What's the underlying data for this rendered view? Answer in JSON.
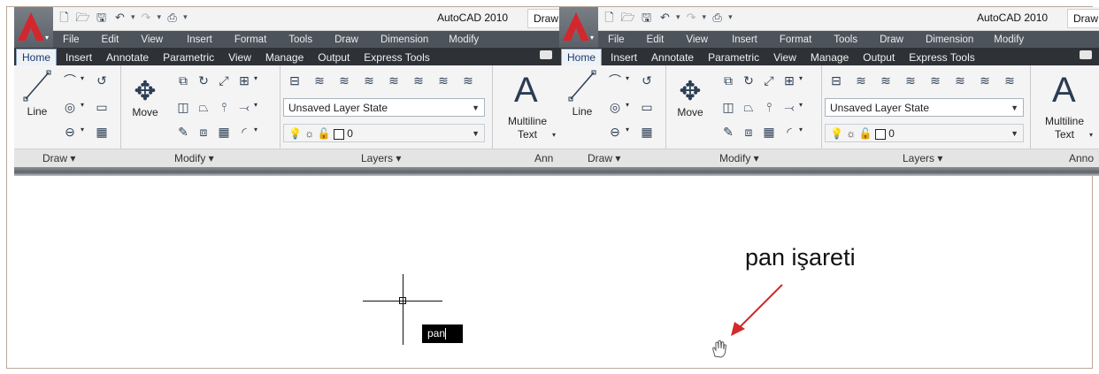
{
  "left_window": {
    "app_title": "AutoCAD 2010",
    "draw_tab": "Draw",
    "menu": [
      "File",
      "Edit",
      "View",
      "Insert",
      "Format",
      "Tools",
      "Draw",
      "Dimension",
      "Modify"
    ],
    "tabs": [
      "Home",
      "Insert",
      "Annotate",
      "Parametric",
      "View",
      "Manage",
      "Output",
      "Express Tools"
    ],
    "active_tab": "Home",
    "tools": {
      "line": "Line",
      "move": "Move",
      "multiline_1": "Multiline",
      "multiline_2": "Text"
    },
    "layer_state": "Unsaved Layer State",
    "layer_value": "0",
    "panels": {
      "draw": "Draw ▾",
      "modify": "Modify ▾",
      "layers": "Layers ▾",
      "annotation": "Ann"
    }
  },
  "right_window": {
    "app_title": "AutoCAD 2010",
    "draw_tab": "Draw",
    "menu": [
      "File",
      "Edit",
      "View",
      "Insert",
      "Format",
      "Tools",
      "Draw",
      "Dimension",
      "Modify"
    ],
    "tabs": [
      "Home",
      "Insert",
      "Annotate",
      "Parametric",
      "View",
      "Manage",
      "Output",
      "Express Tools"
    ],
    "active_tab": "Home",
    "tools": {
      "line": "Line",
      "move": "Move",
      "multiline_1": "Multiline",
      "multiline_2": "Text"
    },
    "layer_state": "Unsaved Layer State",
    "layer_value": "0",
    "panels": {
      "draw": "Draw ▾",
      "modify": "Modify ▾",
      "layers": "Layers ▾",
      "annotation": "Anno"
    }
  },
  "canvas": {
    "command_input": "pan",
    "annotation_label": "pan işareti"
  },
  "colors": {
    "accent": "#d4262d",
    "menubar": "#4d535b",
    "tabstrip": "#2e3237",
    "arrow": "#d42a2a"
  },
  "icons": [
    "autocad-logo-icon",
    "new-icon",
    "open-icon",
    "save-icon",
    "undo-icon",
    "redo-icon",
    "plot-icon",
    "line-icon",
    "polyline-icon",
    "circle-icon",
    "arc-icon",
    "rectangle-icon",
    "hatch-icon",
    "move-icon",
    "copy-icon",
    "rotate-icon",
    "trim-icon",
    "stretch-icon",
    "fillet-icon",
    "mirror-icon",
    "extend-icon",
    "erase-icon",
    "array-icon",
    "scale-icon",
    "layer-properties-icon",
    "lightbulb-icon",
    "sun-icon",
    "lock-icon",
    "color-swatch-icon",
    "multiline-text-icon",
    "crosshair-cursor-icon",
    "hand-pan-cursor-icon",
    "red-arrow-icon"
  ]
}
